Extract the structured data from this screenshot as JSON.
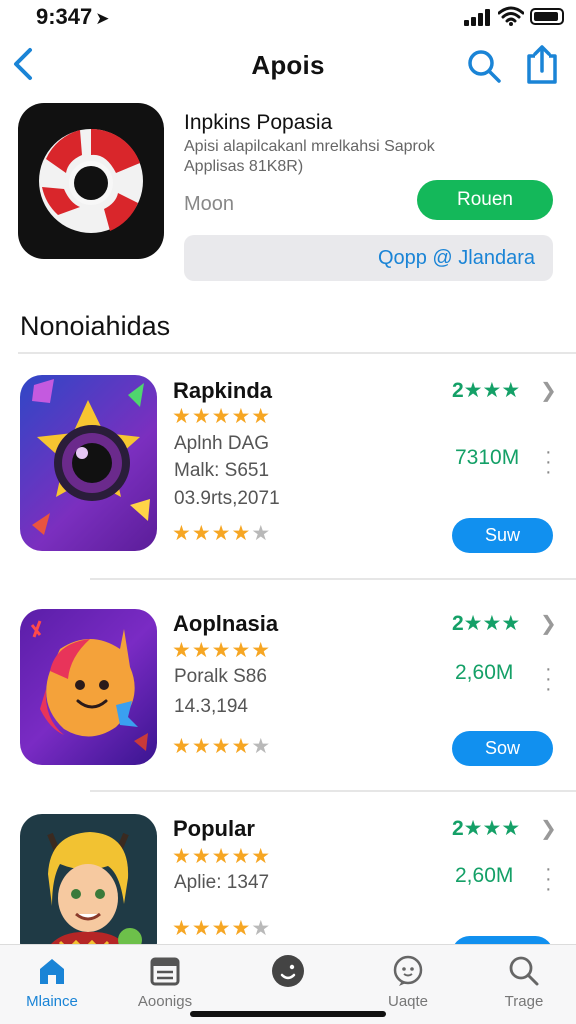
{
  "status_bar": {
    "time": "9:347",
    "location_arrow": "➤"
  },
  "nav": {
    "title": "Apois",
    "back_icon": "chevron-left-icon",
    "search_icon": "search-icon",
    "share_icon": "share-icon"
  },
  "featured": {
    "name": "Inpkins Popasia",
    "desc_line1": "Apisi alapilcakanl mrelkahsi Saprok",
    "desc_line2": "Applisas 81K8R)",
    "meta": "Moon",
    "get_button": "Rouen",
    "wide_button": "Qopp @ Jlandara"
  },
  "section": {
    "title": "Nonoiahidas"
  },
  "apps": [
    {
      "name": "Rapkinda",
      "stars_top": "★★★★★",
      "line1": "Aplnh DAG",
      "line2": "Malk: S651",
      "line3": "03.9rts,2071",
      "stars_bottom_on": "★★★★",
      "stars_bottom_off": "★",
      "rating": "2★★★",
      "size": "7310M",
      "button": "Suw"
    },
    {
      "name": "Aoplnasia",
      "stars_top": "★★★★★",
      "line1": "Poralk S86",
      "line2": "14.3,194",
      "line3": "",
      "stars_bottom_on": "★★★★",
      "stars_bottom_off": "★",
      "rating": "2★★★",
      "size": "2,60M",
      "button": "Sow"
    },
    {
      "name": "Popular",
      "stars_top": "★★★★★",
      "line1": "Aplie: 1347",
      "line2": "",
      "line3": "",
      "stars_bottom_on": "★★★★",
      "stars_bottom_off": "★",
      "rating": "2★★★",
      "size": "2,60M",
      "button": ""
    }
  ],
  "tabs": [
    {
      "label": "Mlaince",
      "icon": "home-icon",
      "active": true
    },
    {
      "label": "Aoonigs",
      "icon": "calendar-icon",
      "active": false
    },
    {
      "label": "",
      "icon": "profile-icon",
      "active": false
    },
    {
      "label": "Uaqte",
      "icon": "chat-icon",
      "active": false
    },
    {
      "label": "Trage",
      "icon": "search-icon",
      "active": false
    }
  ],
  "colors": {
    "accent": "#1a84d6",
    "green": "#14b85a",
    "star": "#f6a623",
    "button_blue": "#1190ef"
  }
}
